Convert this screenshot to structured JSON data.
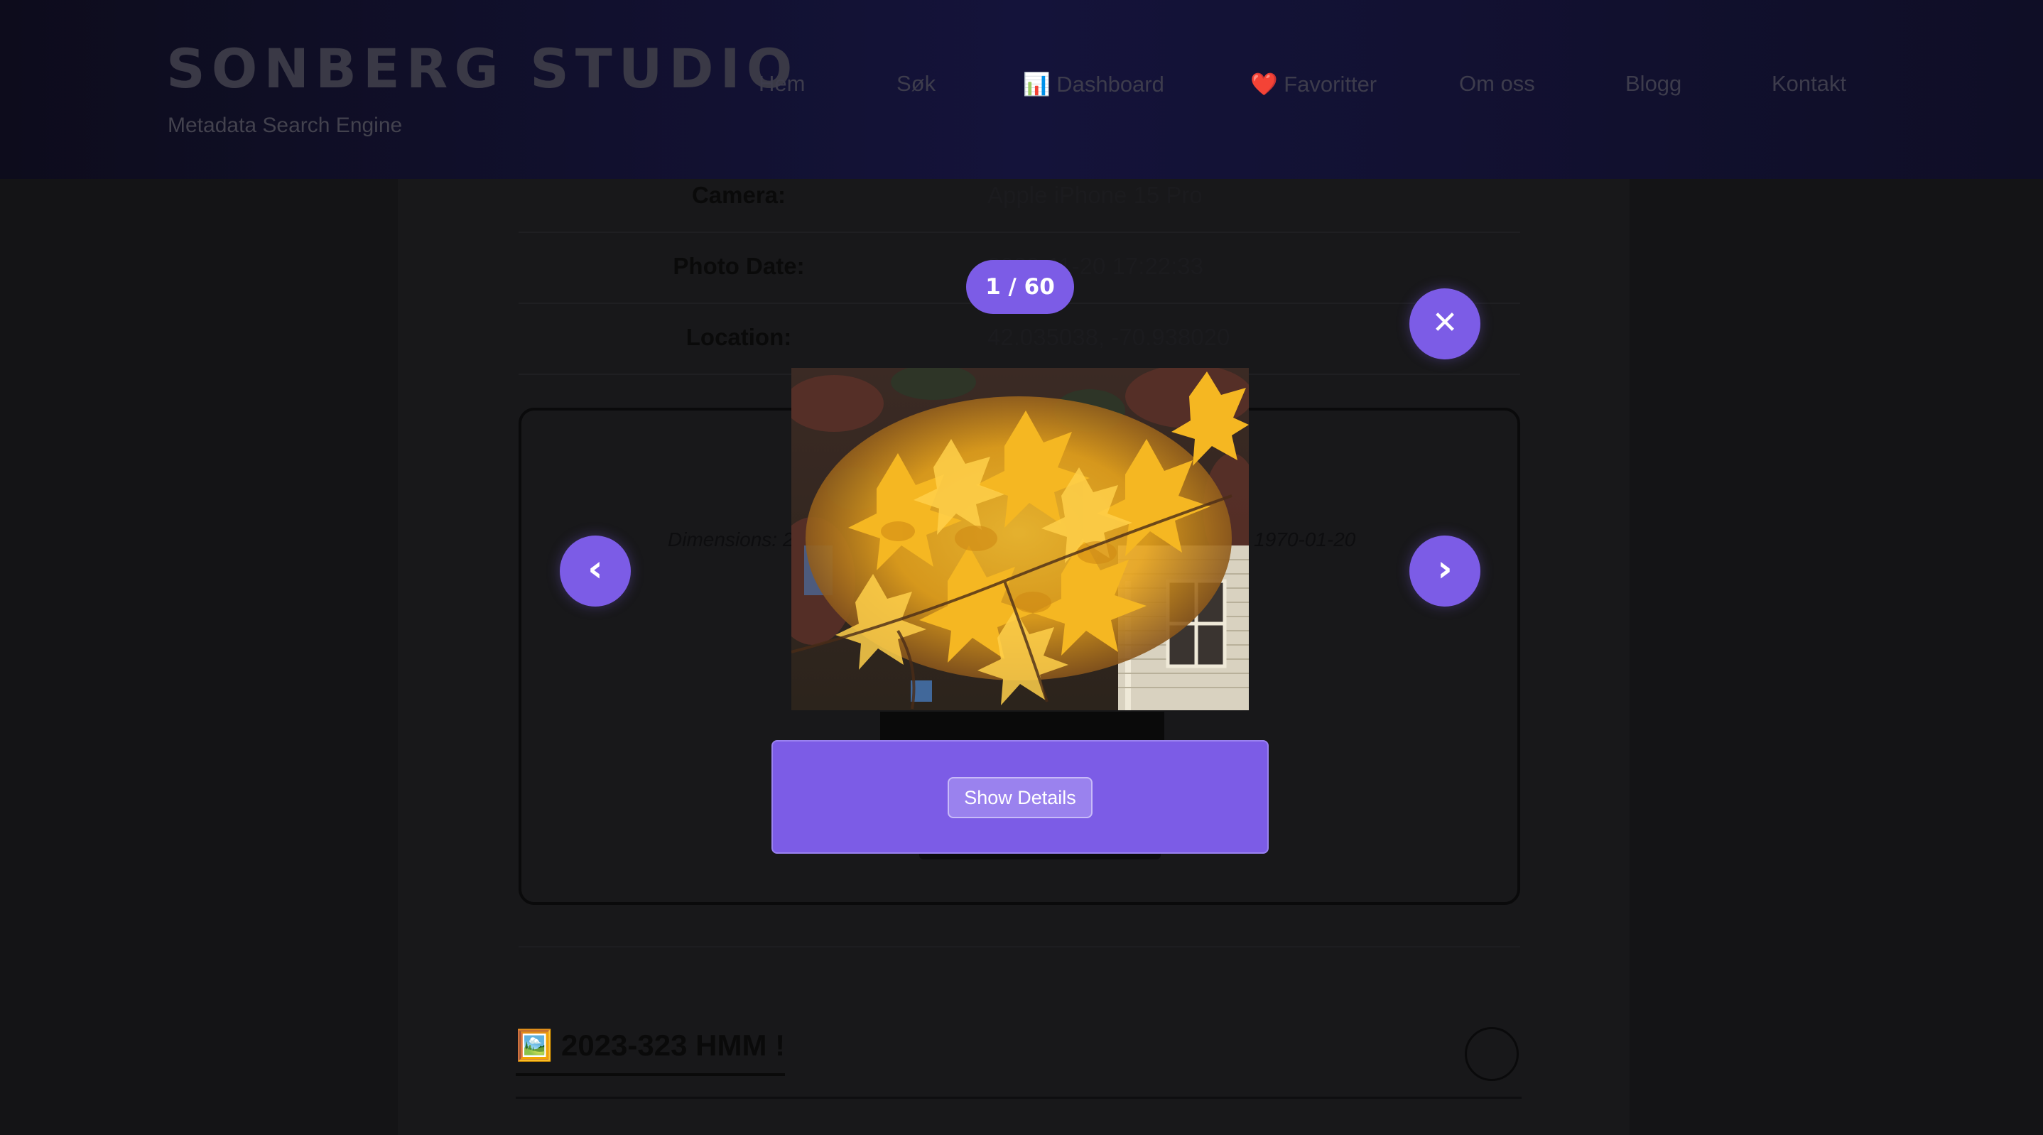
{
  "header": {
    "brand_title": "SONBERG STUDIO",
    "brand_subtitle": "Metadata Search Engine",
    "nav": [
      {
        "label": "Hem"
      },
      {
        "label": "Søk"
      },
      {
        "label": "📊 Dashboard"
      },
      {
        "label": "❤️ Favoritter"
      },
      {
        "label": "Om oss"
      },
      {
        "label": "Blogg"
      },
      {
        "label": "Kontakt"
      }
    ]
  },
  "metadata": [
    {
      "label": "Camera:",
      "value": "Apple iPhone 15 Pro"
    },
    {
      "label": "Photo Date:",
      "value": "2023-11-20 17:22:33"
    },
    {
      "label": "Location:",
      "value": "42.035038, -70.938020"
    }
  ],
  "card": {
    "dimensions_text": "Dimensions: 2",
    "date_text": "e: 1970-01-20"
  },
  "next_section": {
    "title": "🖼️ 2023-323 HMM !"
  },
  "lightbox": {
    "counter": "1 / 60",
    "close_symbol": "✕",
    "prev_symbol": "‹",
    "next_symbol": "›",
    "details_button": "Show Details",
    "accent_color": "#7c5ce6"
  }
}
